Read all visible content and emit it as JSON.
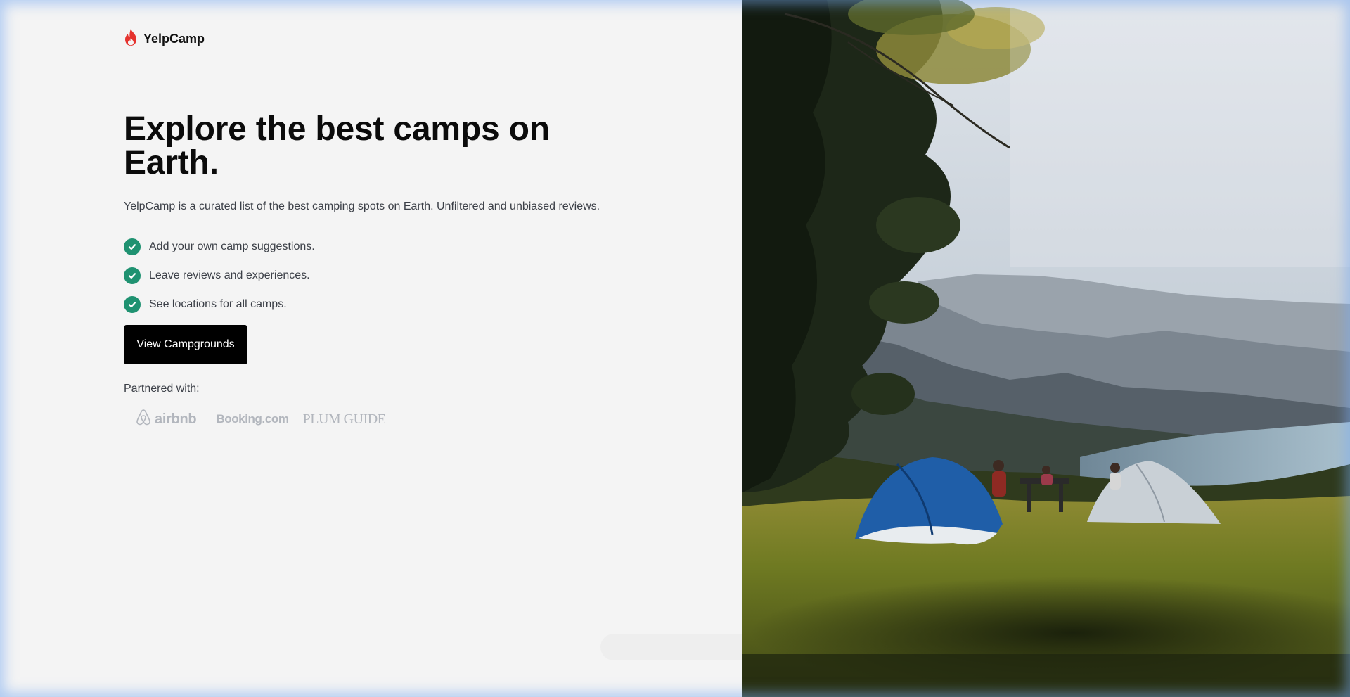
{
  "brand": {
    "name": "YelpCamp",
    "logo_icon": "flame-icon",
    "logo_color": "#e5322d"
  },
  "hero": {
    "headline": "Explore the best camps on Earth.",
    "subtitle": "YelpCamp is a curated list of the best camping spots on Earth. Unfiltered and unbiased reviews.",
    "features": [
      "Add your own camp suggestions.",
      "Leave reviews and experiences.",
      "See locations for all camps."
    ],
    "feature_icon": "check-circle-icon",
    "check_color": "#1f9271",
    "cta_label": "View Campgrounds"
  },
  "partners": {
    "label": "Partnered with:",
    "logos": [
      "airbnb",
      "Booking.com",
      "PLUM GUIDE"
    ]
  }
}
